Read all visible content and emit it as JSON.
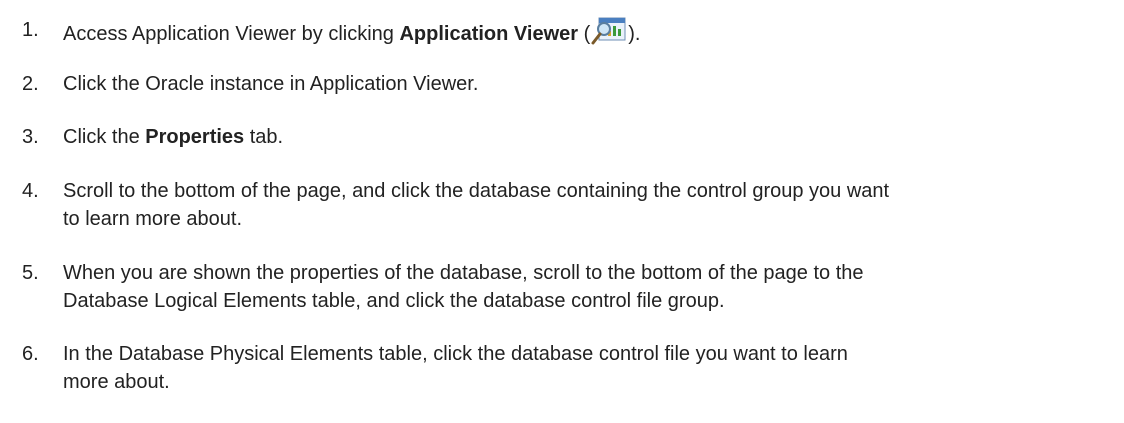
{
  "steps": [
    {
      "number": "1.",
      "pre": "Access Application Viewer by clicking ",
      "bold": "Application Viewer",
      "post_open": " (",
      "icon": "application-viewer-icon",
      "post_close": ")."
    },
    {
      "number": "2.",
      "text": "Click the Oracle instance in Application Viewer."
    },
    {
      "number": "3.",
      "pre": "Click the ",
      "bold": "Properties",
      "post": " tab."
    },
    {
      "number": "4.",
      "line1": "Scroll to the bottom of the page, and click the database containing the control group you want",
      "line2": "to learn more about."
    },
    {
      "number": "5.",
      "line1": "When you are shown the properties of the database, scroll to the bottom of the page to the",
      "line2": "Database Logical Elements table, and click the database control file group."
    },
    {
      "number": "6.",
      "line1": "In the Database Physical Elements table, click the database control file you want to learn",
      "line2": "more about."
    }
  ],
  "colors": {
    "text": "#222222",
    "background": "#ffffff"
  }
}
